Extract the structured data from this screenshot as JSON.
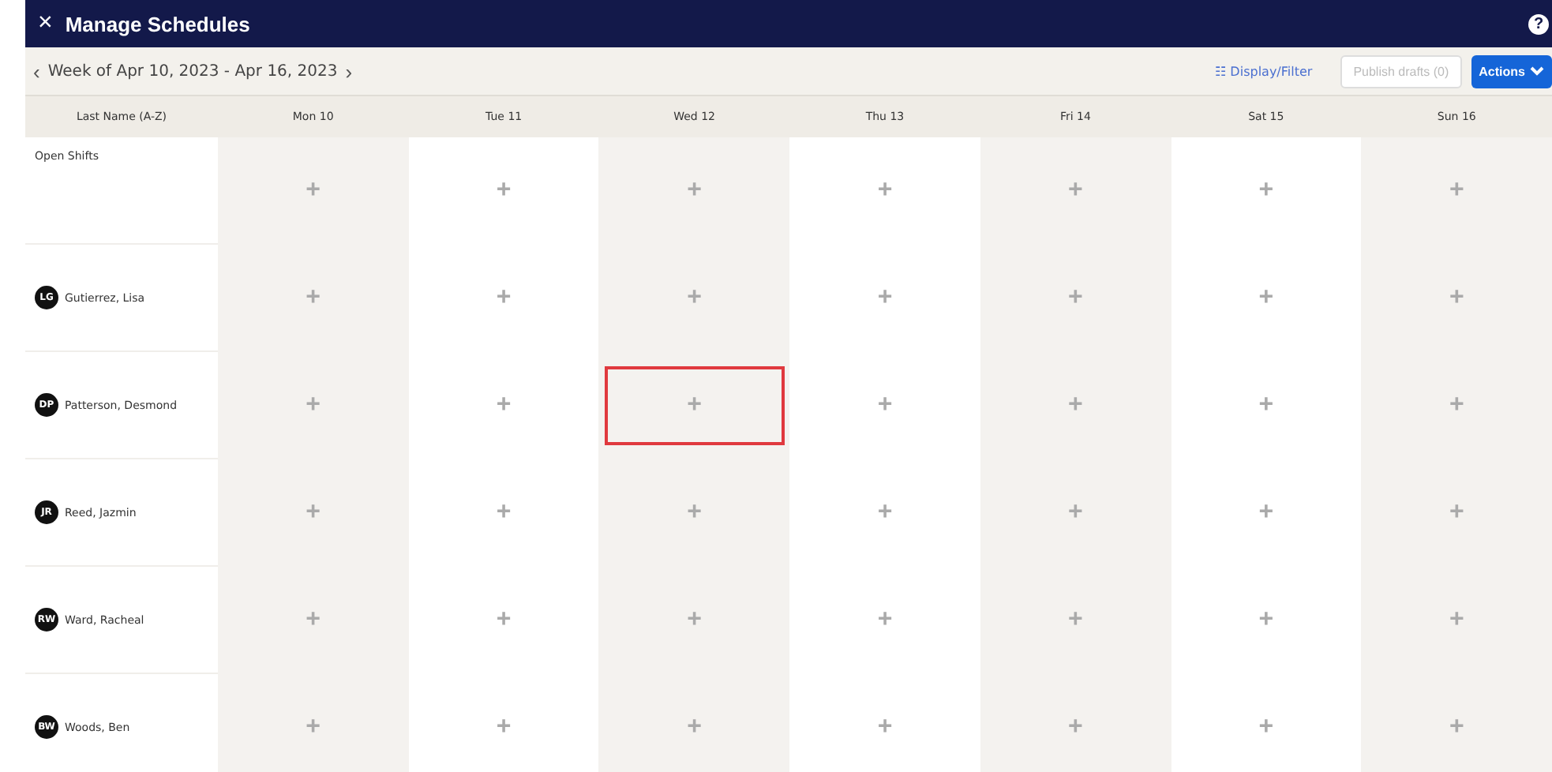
{
  "window": {
    "close": "×",
    "title": "Manage Schedules",
    "help": "?"
  },
  "toolbar": {
    "prev": "‹",
    "week": "Week of Apr 10, 2023 - Apr 16, 2023",
    "next": "›",
    "display_filter": "☷ Display/Filter",
    "publish": {
      "label": "Publish drafts (0)",
      "disabled": true
    },
    "actions": "Actions"
  },
  "table": {
    "columns": [
      "Last Name (A-Z)",
      "Mon 10",
      "Tue 11",
      "Wed 12",
      "Thu 13",
      "Fri 14",
      "Sat 15",
      "Sun 16"
    ],
    "rows": [
      {
        "kind": "open",
        "cells": [
          {
            "name": "Open Shifts"
          },
          {
            "add": "+",
            "highlighted": false
          },
          {
            "add": "+",
            "highlighted": false
          },
          {
            "add": "+",
            "highlighted": false
          },
          {
            "add": "+",
            "highlighted": false
          },
          {
            "add": "+",
            "highlighted": false
          },
          {
            "add": "+",
            "highlighted": false
          },
          {
            "add": "+",
            "highlighted": false
          }
        ]
      },
      {
        "kind": "employee",
        "cells": [
          {
            "initials": "LG",
            "name": "Gutierrez, Lisa"
          },
          {
            "add": "+",
            "highlighted": false
          },
          {
            "add": "+",
            "highlighted": false
          },
          {
            "add": "+",
            "highlighted": false
          },
          {
            "add": "+",
            "highlighted": false
          },
          {
            "add": "+",
            "highlighted": false
          },
          {
            "add": "+",
            "highlighted": false
          },
          {
            "add": "+",
            "highlighted": false
          }
        ]
      },
      {
        "kind": "employee",
        "cells": [
          {
            "initials": "DP",
            "name": "Patterson, Desmond"
          },
          {
            "add": "+",
            "highlighted": false
          },
          {
            "add": "+",
            "highlighted": false
          },
          {
            "add": "+",
            "highlighted": true
          },
          {
            "add": "+",
            "highlighted": false
          },
          {
            "add": "+",
            "highlighted": false
          },
          {
            "add": "+",
            "highlighted": false
          },
          {
            "add": "+",
            "highlighted": false
          }
        ]
      },
      {
        "kind": "employee",
        "cells": [
          {
            "initials": "JR",
            "name": "Reed, Jazmin"
          },
          {
            "add": "+",
            "highlighted": false
          },
          {
            "add": "+",
            "highlighted": false
          },
          {
            "add": "+",
            "highlighted": false
          },
          {
            "add": "+",
            "highlighted": false
          },
          {
            "add": "+",
            "highlighted": false
          },
          {
            "add": "+",
            "highlighted": false
          },
          {
            "add": "+",
            "highlighted": false
          }
        ]
      },
      {
        "kind": "employee",
        "cells": [
          {
            "initials": "RW",
            "name": "Ward, Racheal"
          },
          {
            "add": "+",
            "highlighted": false
          },
          {
            "add": "+",
            "highlighted": false
          },
          {
            "add": "+",
            "highlighted": false
          },
          {
            "add": "+",
            "highlighted": false
          },
          {
            "add": "+",
            "highlighted": false
          },
          {
            "add": "+",
            "highlighted": false
          },
          {
            "add": "+",
            "highlighted": false
          }
        ]
      },
      {
        "kind": "employee",
        "cells": [
          {
            "initials": "BW",
            "name": "Woods, Ben"
          },
          {
            "add": "+",
            "highlighted": false
          },
          {
            "add": "+",
            "highlighted": false
          },
          {
            "add": "+",
            "highlighted": false
          },
          {
            "add": "+",
            "highlighted": false
          },
          {
            "add": "+",
            "highlighted": false
          },
          {
            "add": "+",
            "highlighted": false
          },
          {
            "add": "+",
            "highlighted": false
          }
        ]
      }
    ]
  }
}
